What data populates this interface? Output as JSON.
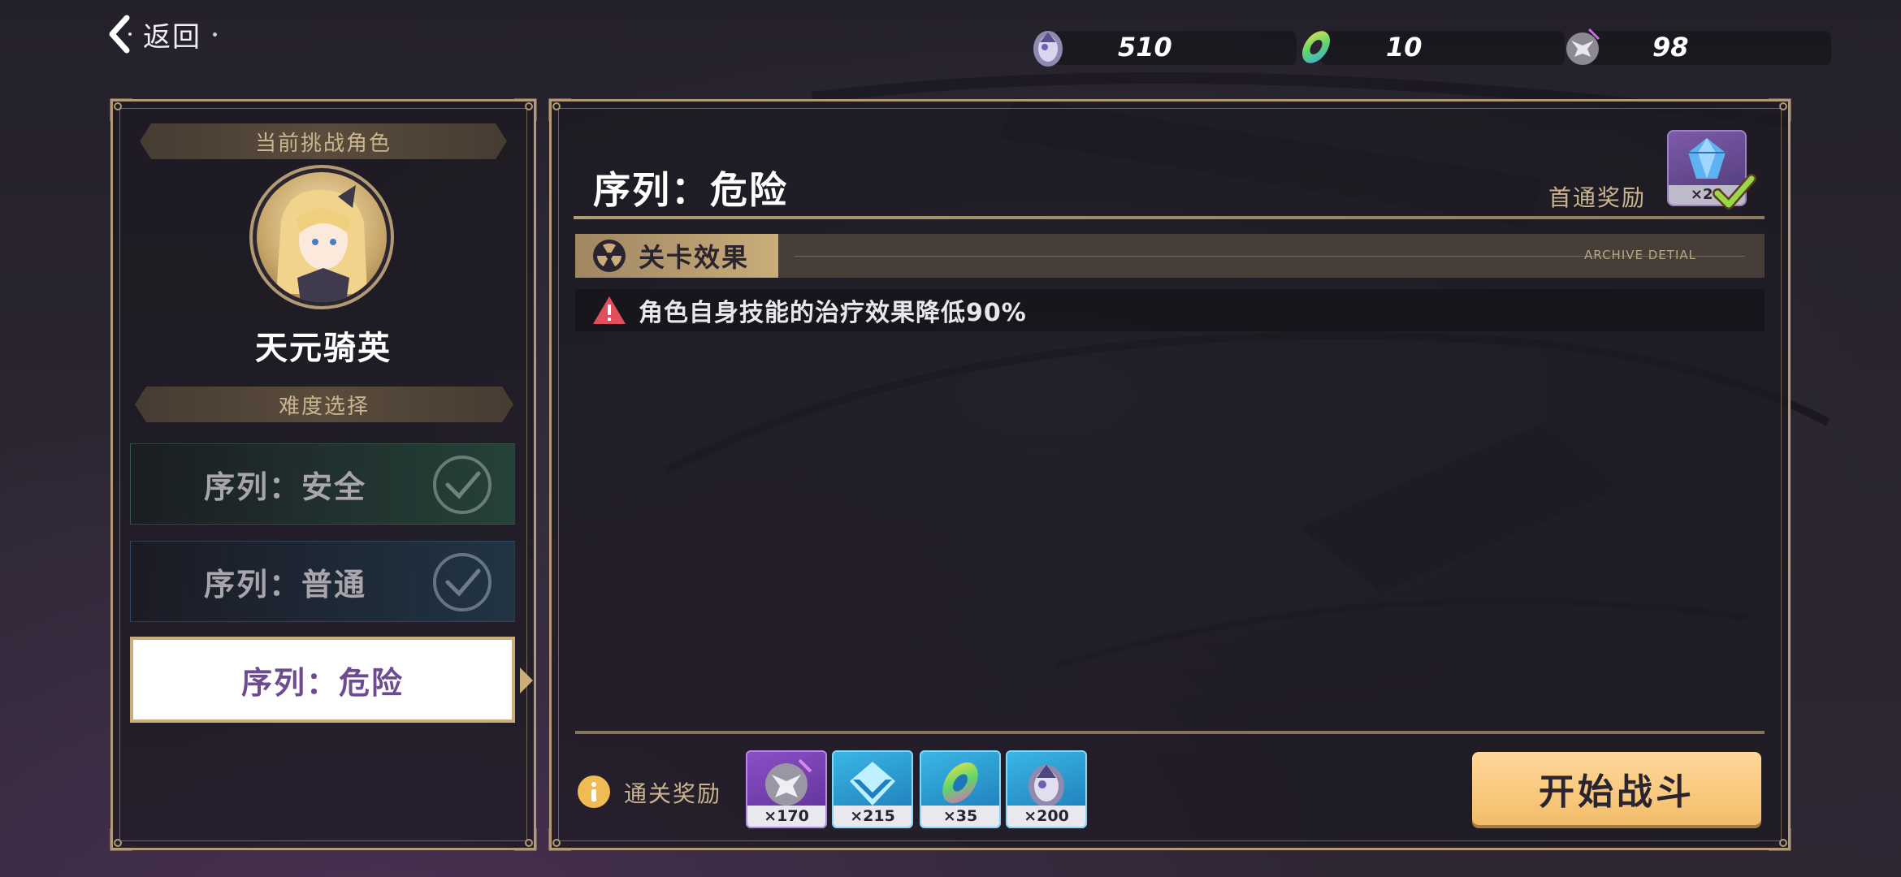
{
  "top_bar": {
    "back_label": "返回",
    "currencies": [
      {
        "icon": "crystal-egg-icon",
        "value": "510"
      },
      {
        "icon": "rainbow-coin-icon",
        "value": "10"
      },
      {
        "icon": "wolf-token-icon",
        "value": "98"
      }
    ]
  },
  "left_panel": {
    "current_challenge_header": "当前挑战角色",
    "character_name": "天元骑英",
    "difficulty_header": "难度选择",
    "difficulties": [
      {
        "label": "序列：安全",
        "state": "cleared"
      },
      {
        "label": "序列：普通",
        "state": "cleared"
      },
      {
        "label": "序列：危险",
        "state": "selected"
      }
    ]
  },
  "right_panel": {
    "stage_title": "序列：危险",
    "first_clear_reward_label": "首通奖励",
    "first_clear_reward": {
      "icon": "blue-crystal-icon",
      "count": "×20",
      "claimed": true
    },
    "effect_tab_label": "关卡效果",
    "archive_label": "ARCHIVE DETIAL",
    "effects": [
      "角色自身技能的治疗效果降低90%"
    ],
    "clear_reward_label": "通关奖励",
    "clear_rewards": [
      {
        "icon": "wolf-token-icon",
        "count": "×170",
        "style": "purple"
      },
      {
        "icon": "blue-chevron-icon",
        "count": "×215",
        "style": "blue"
      },
      {
        "icon": "rainbow-coin-icon",
        "count": "×35",
        "style": "blue"
      },
      {
        "icon": "crystal-egg-icon",
        "count": "×200",
        "style": "blue"
      }
    ],
    "start_button_label": "开始战斗"
  },
  "colors": {
    "gold": "#c9ad7a",
    "start_button": "#f3bd6a",
    "selected_text": "#6e4b8e",
    "warning": "#e0505a"
  }
}
